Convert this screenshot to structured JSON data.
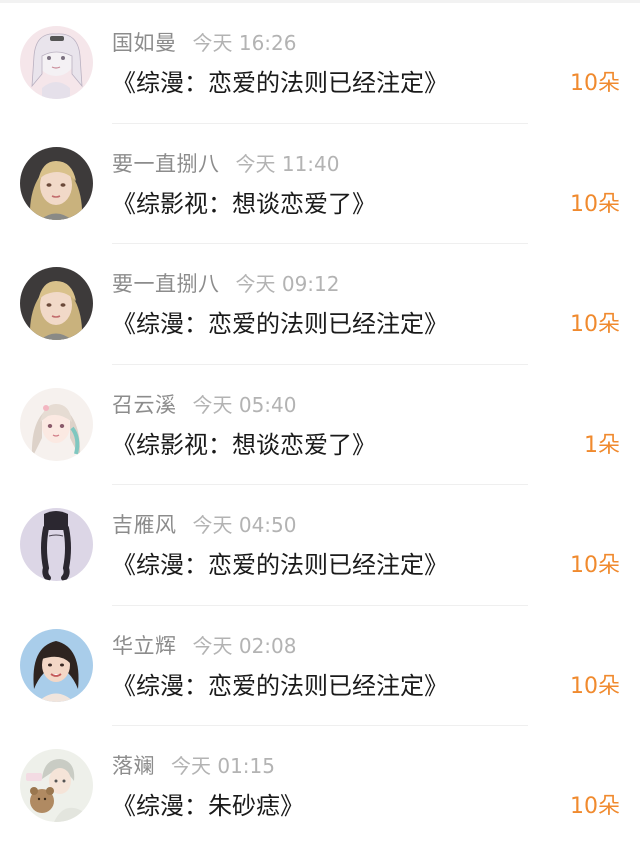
{
  "items": [
    {
      "name": "国如曼",
      "time": "今天 16:26",
      "title": "《综漫：恋爱的法则已经注定》",
      "gift": "10朵",
      "avatar_icon": "anime-girl-white-hair-avatar"
    },
    {
      "name": "要一直捌八",
      "time": "今天 11:40",
      "title": "《综影视：想谈恋爱了》",
      "gift": "10朵",
      "avatar_icon": "blonde-girl-portrait-avatar"
    },
    {
      "name": "要一直捌八",
      "time": "今天 09:12",
      "title": "《综漫：恋爱的法则已经注定》",
      "gift": "10朵",
      "avatar_icon": "blonde-girl-portrait-avatar"
    },
    {
      "name": "召云溪",
      "time": "今天 05:40",
      "title": "《综影视：想谈恋爱了》",
      "gift": "1朵",
      "avatar_icon": "anime-girl-teal-hair-avatar"
    },
    {
      "name": "吉雁风",
      "time": "今天 04:50",
      "title": "《综漫：恋爱的法则已经注定》",
      "gift": "10朵",
      "avatar_icon": "black-braids-avatar"
    },
    {
      "name": "华立辉",
      "time": "今天 02:08",
      "title": "《综漫：恋爱的法则已经注定》",
      "gift": "10朵",
      "avatar_icon": "woman-photo-avatar"
    },
    {
      "name": "落斓",
      "time": "今天 01:15",
      "title": "《综漫：朱砂痣》",
      "gift": "10朵",
      "avatar_icon": "anime-boy-teddy-bear-avatar"
    }
  ],
  "colors": {
    "name": "#8c8c8c",
    "time": "#b3b3b3",
    "title": "#1a1a1a",
    "gift": "#f08a2e"
  }
}
